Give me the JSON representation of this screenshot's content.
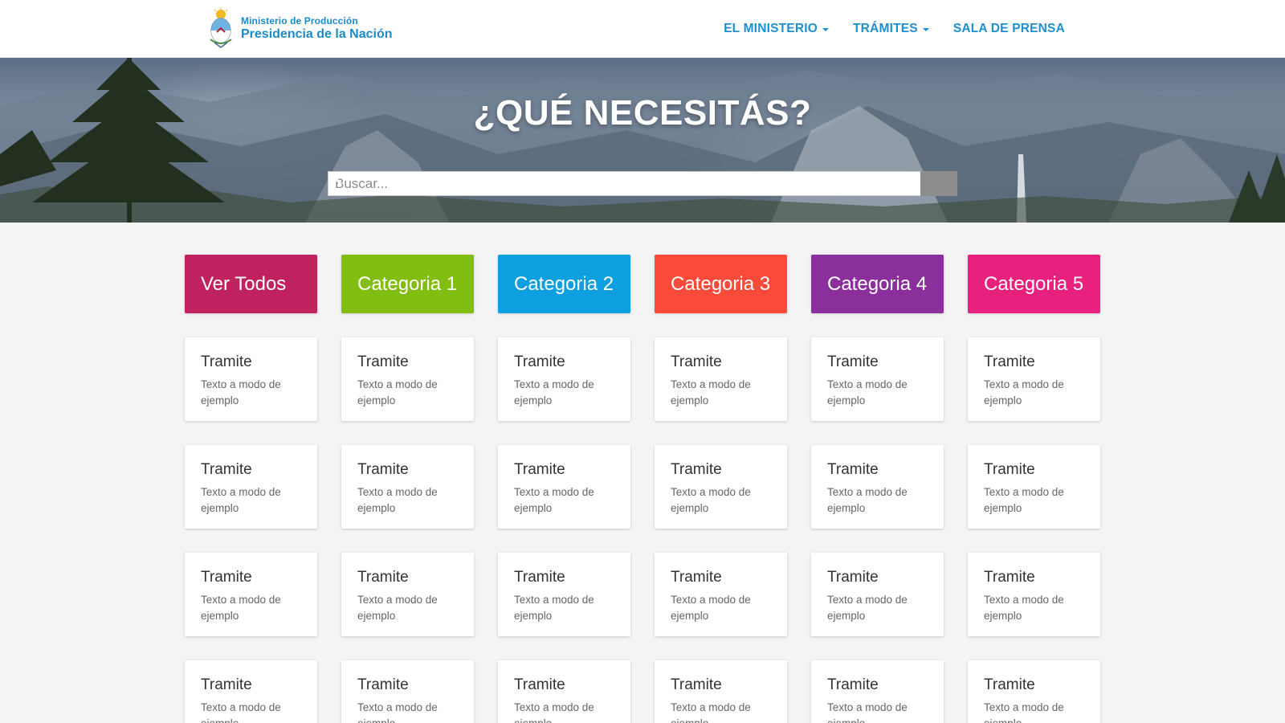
{
  "header": {
    "logo_line1": "Ministerio de Producción",
    "logo_line2": "Presidencia de la Nación",
    "nav": [
      {
        "label": "EL MINISTERIO",
        "dropdown": true
      },
      {
        "label": "TRÁMITES",
        "dropdown": true
      },
      {
        "label": "SALA DE PRENSA",
        "dropdown": false
      }
    ]
  },
  "hero": {
    "title": "¿QUÉ NECESITÁS?",
    "search_placeholder": "Buscar...",
    "search_icon": "search-icon"
  },
  "categories": [
    {
      "label": "Ver Todos",
      "color": "#c0215f"
    },
    {
      "label": "Categoria 1",
      "color": "#82bd12"
    },
    {
      "label": "Categoria 2",
      "color": "#0d9fe0"
    },
    {
      "label": "Categoria 3",
      "color": "#fa4a3a"
    },
    {
      "label": "Categoria 4",
      "color": "#8a2f9c"
    },
    {
      "label": "Categoria 5",
      "color": "#e8217e"
    }
  ],
  "cards": [
    {
      "title": "Tramite",
      "desc": "Texto a modo de ejemplo"
    },
    {
      "title": "Tramite",
      "desc": "Texto a modo de ejemplo"
    },
    {
      "title": "Tramite",
      "desc": "Texto a modo de ejemplo"
    },
    {
      "title": "Tramite",
      "desc": "Texto a modo de ejemplo"
    },
    {
      "title": "Tramite",
      "desc": "Texto a modo de ejemplo"
    },
    {
      "title": "Tramite",
      "desc": "Texto a modo de ejemplo"
    },
    {
      "title": "Tramite",
      "desc": "Texto a modo de ejemplo"
    },
    {
      "title": "Tramite",
      "desc": "Texto a modo de ejemplo"
    },
    {
      "title": "Tramite",
      "desc": "Texto a modo de ejemplo"
    },
    {
      "title": "Tramite",
      "desc": "Texto a modo de ejemplo"
    },
    {
      "title": "Tramite",
      "desc": "Texto a modo de ejemplo"
    },
    {
      "title": "Tramite",
      "desc": "Texto a modo de ejemplo"
    },
    {
      "title": "Tramite",
      "desc": "Texto a modo de ejemplo"
    },
    {
      "title": "Tramite",
      "desc": "Texto a modo de ejemplo"
    },
    {
      "title": "Tramite",
      "desc": "Texto a modo de ejemplo"
    },
    {
      "title": "Tramite",
      "desc": "Texto a modo de ejemplo"
    },
    {
      "title": "Tramite",
      "desc": "Texto a modo de ejemplo"
    },
    {
      "title": "Tramite",
      "desc": "Texto a modo de ejemplo"
    },
    {
      "title": "Tramite",
      "desc": "Texto a modo de ejemplo"
    },
    {
      "title": "Tramite",
      "desc": "Texto a modo de ejemplo"
    },
    {
      "title": "Tramite",
      "desc": "Texto a modo de ejemplo"
    },
    {
      "title": "Tramite",
      "desc": "Texto a modo de ejemplo"
    },
    {
      "title": "Tramite",
      "desc": "Texto a modo de ejemplo"
    },
    {
      "title": "Tramite",
      "desc": "Texto a modo de ejemplo"
    }
  ],
  "colors": {
    "brand_blue": "#1a8bc7",
    "nav_blue": "#1e8fcf",
    "page_bg": "#f4f4f4",
    "search_button": "#8d8d8d"
  }
}
